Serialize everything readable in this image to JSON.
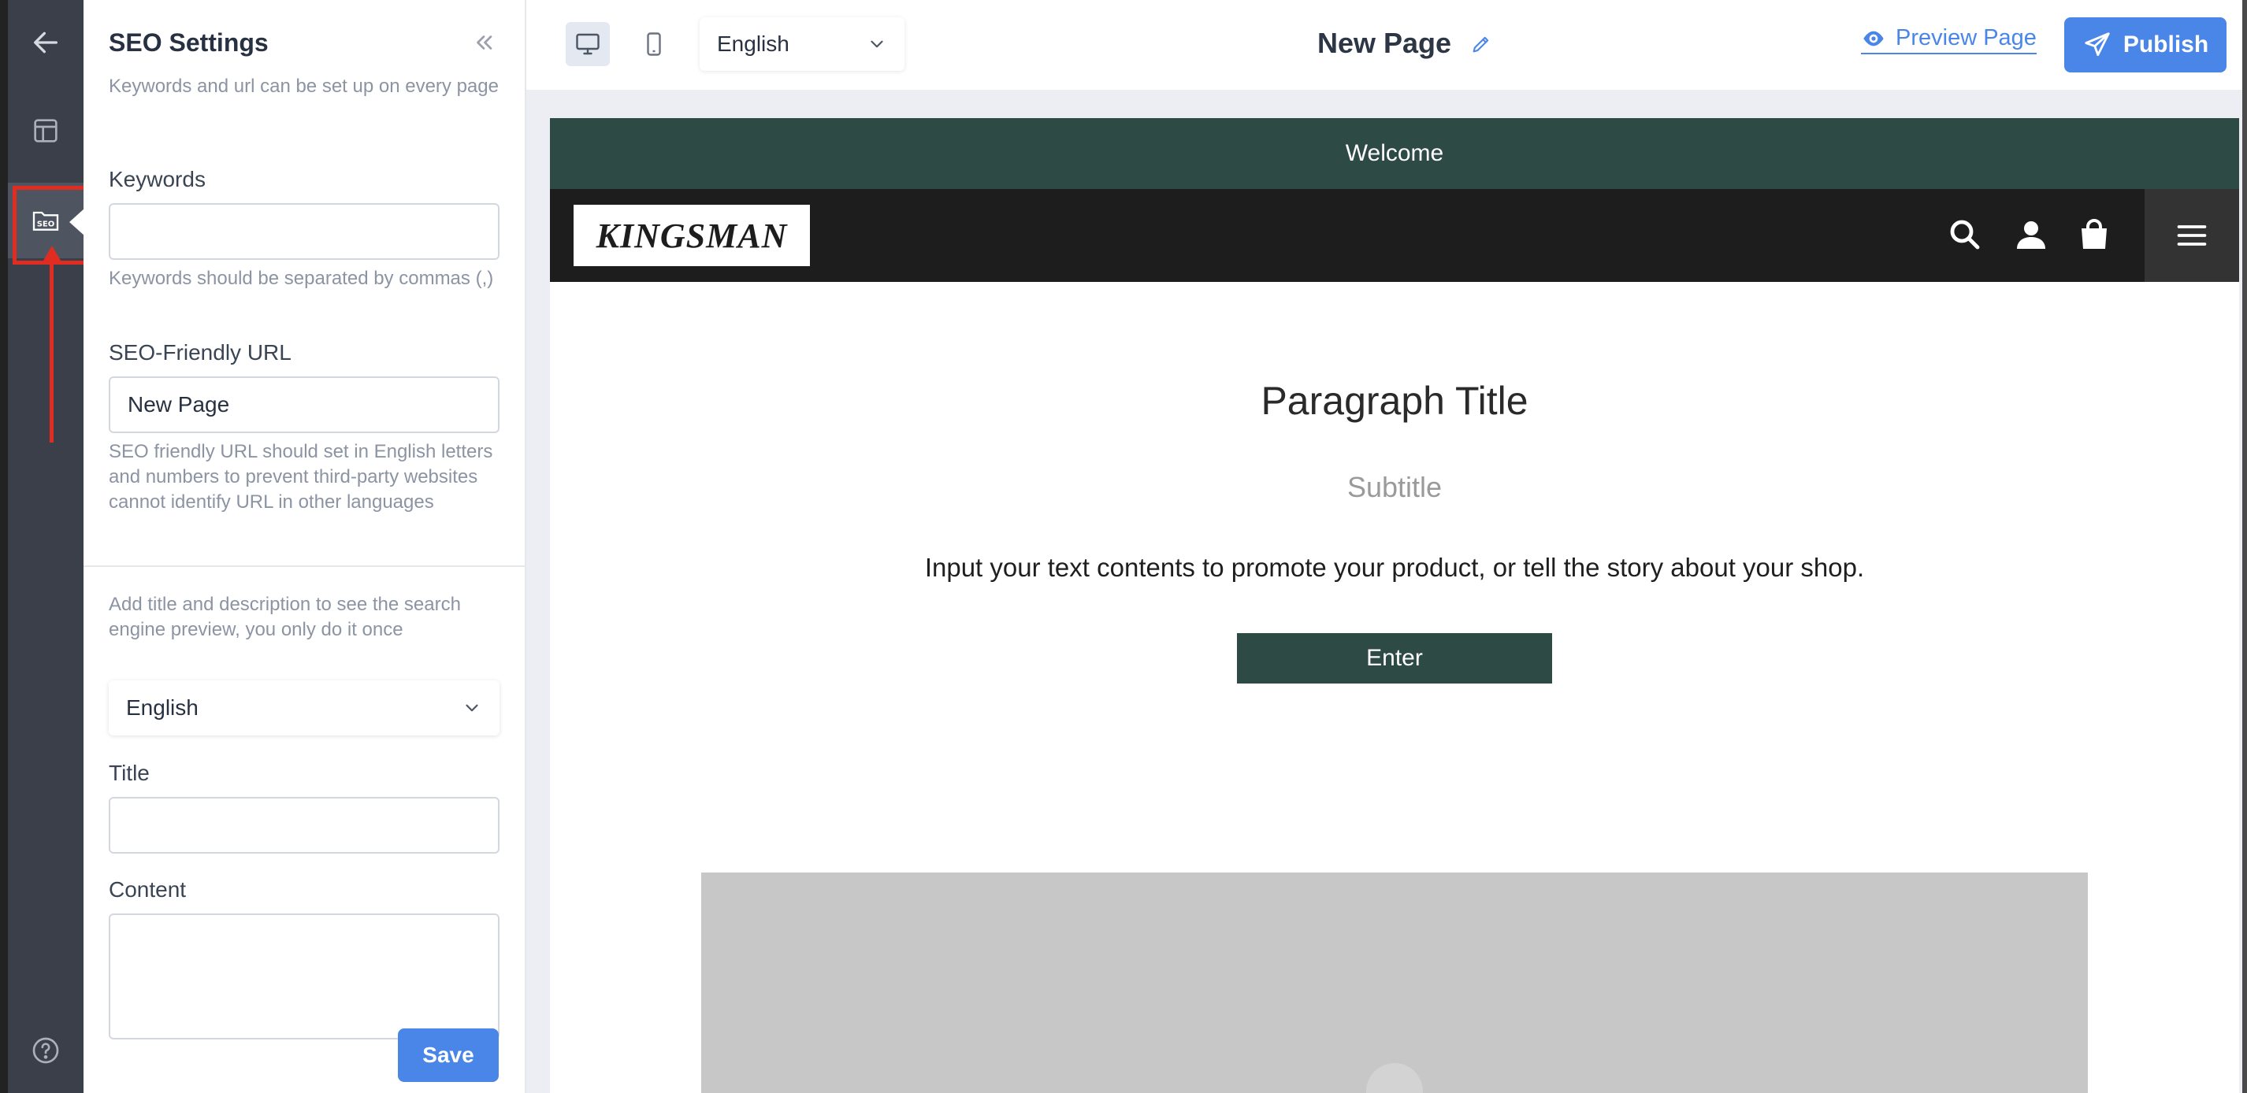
{
  "colors": {
    "accent": "#4a86e8",
    "rail_bg": "#3b3f4a",
    "welcome_bg": "#2e4a44",
    "navbar_bg": "#1d1d1d",
    "highlight": "#e12d21",
    "image_placeholder": "#c7c7c7"
  },
  "rail": {
    "items": [
      {
        "icon": "back-arrow-icon"
      },
      {
        "icon": "layout-icon"
      },
      {
        "icon": "seo-icon",
        "active": true
      },
      {
        "icon": "help-icon"
      }
    ]
  },
  "panel": {
    "title": "SEO Settings",
    "intro": "Keywords and url can be set up on every page",
    "keywords_label": "Keywords",
    "keywords_value": "",
    "keywords_hint": "Keywords should be separated by commas (,)",
    "url_label": "SEO-Friendly URL",
    "url_value": "New Page",
    "url_hint": "SEO friendly URL should set in English letters and numbers to prevent third-party websites cannot identify URL in other languages",
    "preview_hint": "Add title and description to see the search engine preview, you only do it once",
    "language_selected": "English",
    "title_label": "Title",
    "title_value": "",
    "content_label": "Content",
    "content_value": "",
    "save_label": "Save"
  },
  "topbar": {
    "language_selected": "English",
    "page_name": "New Page",
    "preview_label": "Preview Page",
    "publish_label": "Publish"
  },
  "preview": {
    "welcome_text": "Welcome",
    "logo_text": "KINGSMAN",
    "paragraph_title": "Paragraph Title",
    "subtitle": "Subtitle",
    "body_text": "Input your text contents to promote your product, or tell the story about your shop.",
    "button_label": "Enter"
  }
}
